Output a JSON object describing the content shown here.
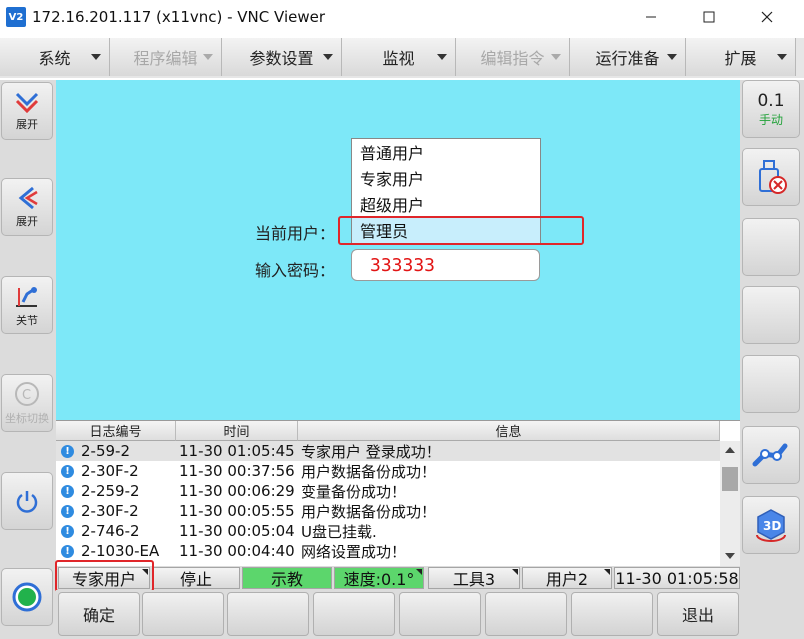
{
  "window": {
    "title": "172.16.201.117 (x11vnc) - VNC Viewer",
    "logo_text": "V2"
  },
  "menu": [
    {
      "label": "系统",
      "enabled": true
    },
    {
      "label": "程序编辑",
      "enabled": false
    },
    {
      "label": "参数设置",
      "enabled": true
    },
    {
      "label": "监视",
      "enabled": true
    },
    {
      "label": "编辑指令",
      "enabled": false
    },
    {
      "label": "运行准备",
      "enabled": true
    },
    {
      "label": "扩展",
      "enabled": true
    }
  ],
  "left_panel": {
    "expand1": "展开",
    "expand2": "展开",
    "joint": "关节",
    "coord_disabled": "坐标切换"
  },
  "right_panel": {
    "speed_value": "0.1",
    "mode": "手动"
  },
  "login": {
    "current_user_label": "当前用户：",
    "password_label": "输入密码：",
    "password_value": "333333",
    "options": [
      "普通用户",
      "专家用户",
      "超级用户",
      "管理员"
    ],
    "selected": "管理员"
  },
  "log": {
    "headers": {
      "code": "日志编号",
      "time": "时间",
      "info": "信息"
    },
    "rows": [
      {
        "code": "2-59-2",
        "time": "11-30 01:05:45",
        "info": "专家用户 登录成功！"
      },
      {
        "code": "2-30F-2",
        "time": "11-30 00:37:56",
        "info": "用户数据备份成功！"
      },
      {
        "code": "2-259-2",
        "time": "11-30 00:06:29",
        "info": "变量备份成功！"
      },
      {
        "code": "2-30F-2",
        "time": "11-30 00:05:55",
        "info": "用户数据备份成功！"
      },
      {
        "code": "2-746-2",
        "time": "11-30 00:05:04",
        "info": "U盘已挂载."
      },
      {
        "code": "2-1030-EA",
        "time": "11-30 00:04:40",
        "info": "网络设置成功！"
      }
    ]
  },
  "status": {
    "user": "专家用户",
    "run_state": "停止",
    "mode": "示教",
    "speed": "速度:0.1°",
    "tool": "工具3",
    "user_frame": "用户2",
    "datetime": "11-30 01:05:58"
  },
  "bottom": {
    "confirm": "确定",
    "exit": "退出"
  },
  "colors": {
    "main_bg": "#7de8f8",
    "highlight_red": "#e0262a",
    "green_state": "#5cd66c",
    "password_text": "#e21414"
  }
}
